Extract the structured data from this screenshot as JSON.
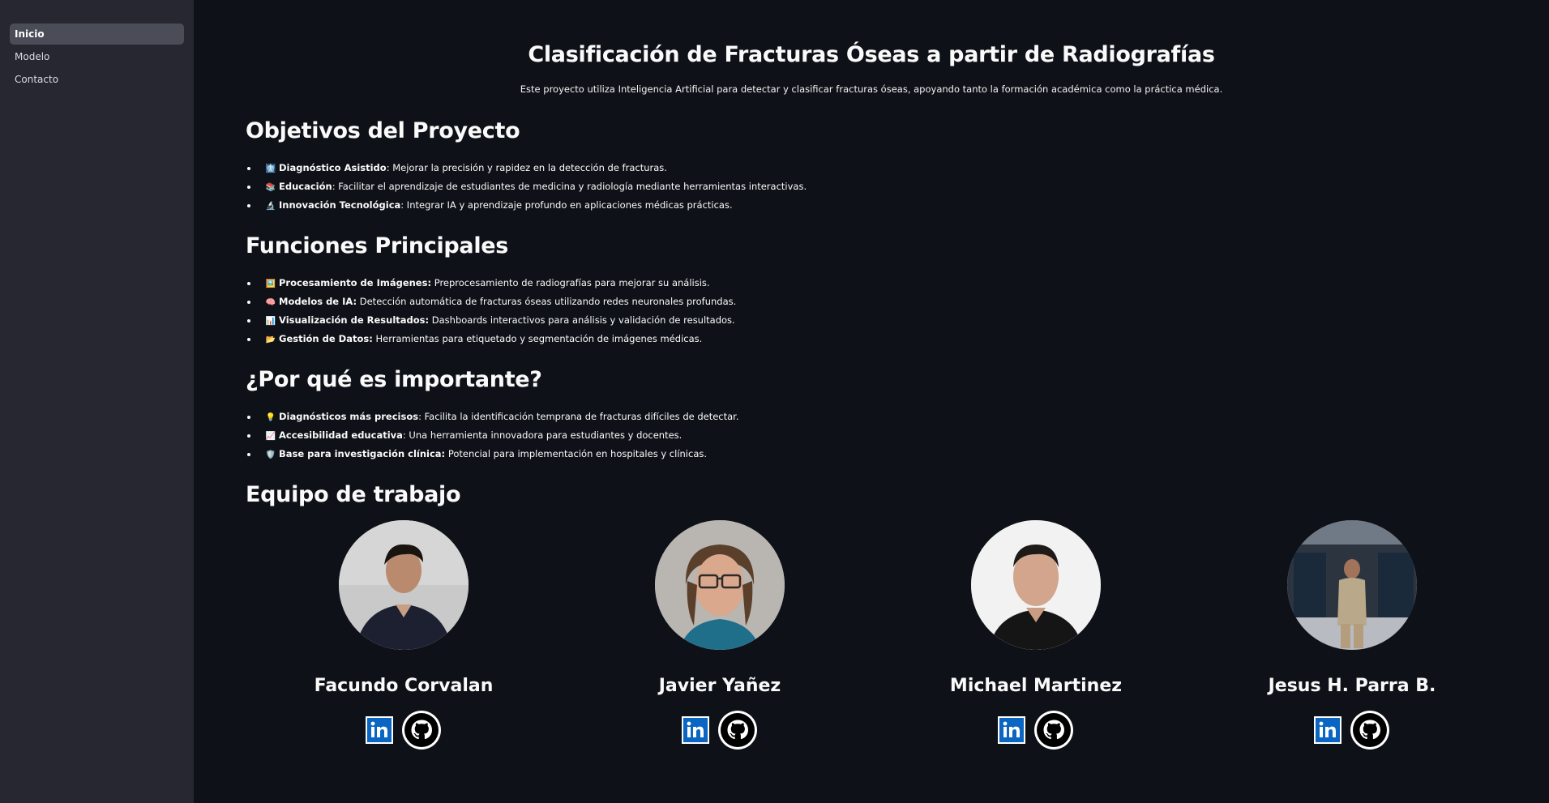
{
  "sidebar": {
    "items": [
      {
        "label": "Inicio",
        "active": true
      },
      {
        "label": "Modelo",
        "active": false
      },
      {
        "label": "Contacto",
        "active": false
      }
    ]
  },
  "main": {
    "title": "Clasificación de Fracturas Óseas a partir de Radiografías",
    "intro": "Este proyecto utiliza Inteligencia Artificial para detectar y clasificar fracturas óseas, apoyando tanto la formación académica como la práctica médica.",
    "sections": [
      {
        "heading": "Objetivos del Proyecto",
        "items": [
          {
            "emoji": "🩻",
            "bold": "Diagnóstico Asistido",
            "text": ": Mejorar la precisión y rapidez en la detección de fracturas."
          },
          {
            "emoji": "📚",
            "bold": "Educación",
            "text": ": Facilitar el aprendizaje de estudiantes de medicina y radiología mediante herramientas interactivas."
          },
          {
            "emoji": "🔬",
            "bold": "Innovación Tecnológica",
            "text": ": Integrar IA y aprendizaje profundo en aplicaciones médicas prácticas."
          }
        ]
      },
      {
        "heading": "Funciones Principales",
        "items": [
          {
            "emoji": "🖼️",
            "bold": "Procesamiento de Imágenes:",
            "text": " Preprocesamiento de radiografías para mejorar su análisis."
          },
          {
            "emoji": "🧠",
            "bold": "Modelos de IA:",
            "text": " Detección automática de fracturas óseas utilizando redes neuronales profundas."
          },
          {
            "emoji": "📊",
            "bold": "Visualización de Resultados:",
            "text": " Dashboards interactivos para análisis y validación de resultados."
          },
          {
            "emoji": "📂",
            "bold": "Gestión de Datos:",
            "text": " Herramientas para etiquetado y segmentación de imágenes médicas."
          }
        ]
      },
      {
        "heading": "¿Por qué es importante?",
        "items": [
          {
            "emoji": "💡",
            "bold": "Diagnósticos más precisos",
            "text": ": Facilita la identificación temprana de fracturas difíciles de detectar."
          },
          {
            "emoji": "📈",
            "bold": "Accesibilidad educativa",
            "text": ": Una herramienta innovadora para estudiantes y docentes."
          },
          {
            "emoji": "🛡️",
            "bold": "Base para investigación clínica:",
            "text": " Potencial para implementación en hospitales y clínicas."
          }
        ]
      }
    ],
    "team": {
      "heading": "Equipo de trabajo",
      "members": [
        {
          "name": "Facundo Corvalan",
          "linkedin_icon": "linkedin-icon",
          "github_icon": "github-icon"
        },
        {
          "name": "Javier Yañez",
          "linkedin_icon": "linkedin-icon",
          "github_icon": "github-icon"
        },
        {
          "name": "Michael Martinez",
          "linkedin_icon": "linkedin-icon",
          "github_icon": "github-icon"
        },
        {
          "name": "Jesus H. Parra B.",
          "linkedin_icon": "linkedin-icon",
          "github_icon": "github-icon"
        }
      ]
    }
  },
  "colors": {
    "background": "#0e1117",
    "sidebar": "#262730",
    "sidebar_active": "#4a4c58",
    "text": "#fafafa",
    "linkedin": "#0a66c2"
  }
}
